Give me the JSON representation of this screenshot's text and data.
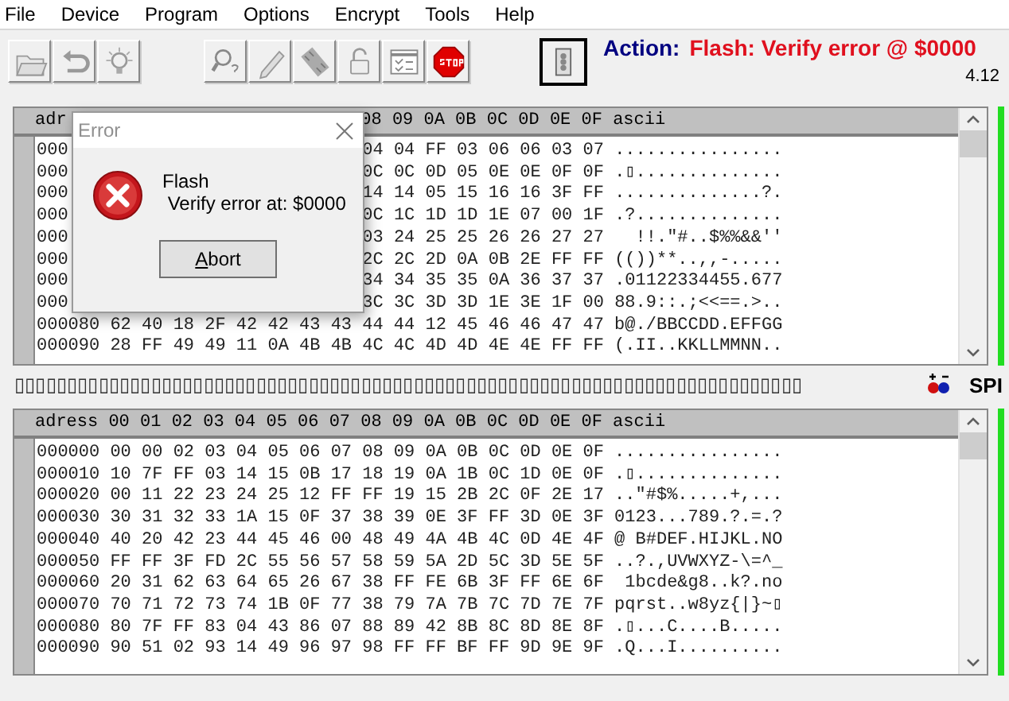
{
  "menu": [
    "File",
    "Device",
    "Program",
    "Options",
    "Encrypt",
    "Tools",
    "Help"
  ],
  "action": {
    "label": "Action:",
    "message": "Flash: Verify error @ $0000"
  },
  "version": "4.12",
  "buffers": [
    {
      "header": {
        "lead": "adr",
        "tail": "08 09 0A 0B 0C 0D 0E 0F ascii"
      },
      "rows": [
        {
          "lead": "000",
          "tail": "04 04 FF 03 06 06 03 07 ................"
        },
        {
          "lead": "000",
          "tail": "0C 0C 0D 05 0E 0E 0F 0F .▯.............."
        },
        {
          "lead": "000",
          "tail": "14 14 05 15 16 16 3F FF ..............?."
        },
        {
          "lead": "000",
          "tail": "0C 1C 1D 1D 1E 07 00 1F .?.............."
        },
        {
          "lead": "000",
          "tail": "03 24 25 25 26 26 27 27   !!.\"#..$%%&&''"
        },
        {
          "lead": "000",
          "tail": "2C 2C 2D 0A 0B 2E FF FF (())**..,,-....."
        },
        {
          "lead": "000",
          "tail": "34 34 35 35 0A 36 37 37 .01122334455.677"
        },
        {
          "lead": "000",
          "tail": "3C 3C 3D 3D 1E 3E 1F 00 88.9::.;<<==.>.."
        },
        {
          "text": "000080 62 40 18 2F 42 42 43 43 44 44 12 45 46 46 47 47 b@./BBCCDD.EFFGG"
        },
        {
          "text": "000090 28 FF 49 49 11 0A 4B 4B 4C 4C 4D 4D 4E 4E FF FF (.II..KKLLMMNN.."
        }
      ]
    },
    {
      "header": {
        "text": "adress 00 01 02 03 04 05 06 07 08 09 0A 0B 0C 0D 0E 0F ascii"
      },
      "rows": [
        {
          "text": "000000 00 00 02 03 04 05 06 07 08 09 0A 0B 0C 0D 0E 0F ................"
        },
        {
          "text": "000010 10 7F FF 03 14 15 0B 17 18 19 0A 1B 0C 1D 0E 0F .▯.............."
        },
        {
          "text": "000020 00 11 22 23 24 25 12 FF FF 19 15 2B 2C 0F 2E 17 ..\"#$%.....+,..."
        },
        {
          "text": "000030 30 31 32 33 1A 15 0F 37 38 39 0E 3F FF 3D 0E 3F 0123...789.?.=.?"
        },
        {
          "text": "000040 40 20 42 23 44 45 46 00 48 49 4A 4B 4C 0D 4E 4F @ B#DEF.HIJKL.NO"
        },
        {
          "text": "000050 FF FF 3F FD 2C 55 56 57 58 59 5A 2D 5C 3D 5E 5F ..?.,UVWXYZ-\\=^_"
        },
        {
          "text": "000060 20 31 62 63 64 65 26 67 38 FF FE 6B 3F FF 6E 6F  1bcde&g8..k?.no"
        },
        {
          "text": "000070 70 71 72 73 74 1B 0F 77 38 79 7A 7B 7C 7D 7E 7F pqrst..w8yz{|}~▯"
        },
        {
          "text": "000080 80 7F FF 83 04 43 86 07 88 89 42 8B 8C 8D 8E 8F .▯...C....B....."
        },
        {
          "text": "000090 90 51 02 93 14 49 96 97 98 FF FF BF FF 9D 9E 9F .Q...I.........."
        }
      ]
    }
  ],
  "strip": {
    "text": "▯▯▯▯▯▯▯▯▯▯▯▯▯▯▯▯▯▯▯▯▯▯▯▯▯▯▯▯▯▯▯▯▯▯▯▯▯▯▯▯▯▯▯▯▯▯▯▯▯▯▯▯▯▯▯▯▯▯▯▯▯▯▯▯▯▯▯▯▯▯▯▯▯▯▯",
    "protocol": "SPI"
  },
  "dialog": {
    "title": "Error",
    "heading": "Flash",
    "message": " Verify error at: $0000",
    "button": "Abort"
  }
}
